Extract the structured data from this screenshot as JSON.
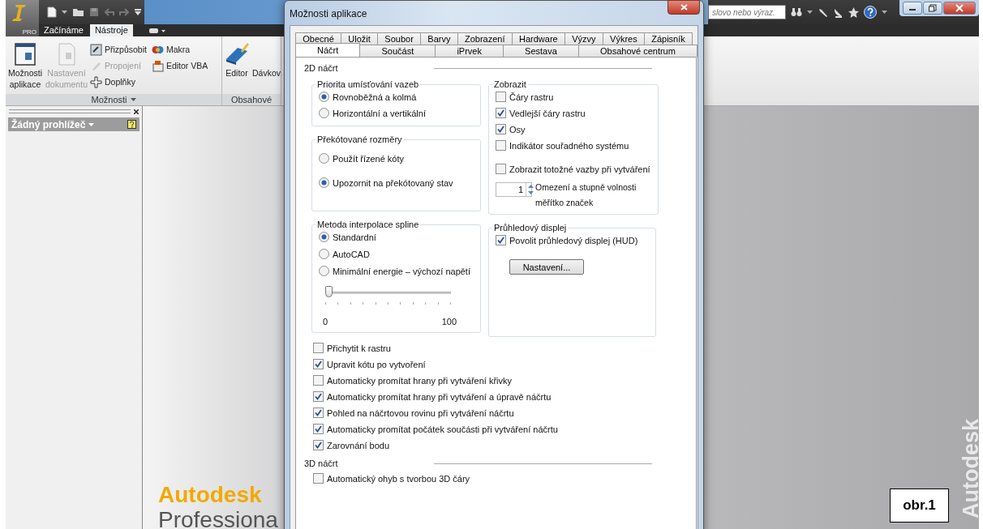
{
  "app": {
    "logo_badge": "PRO",
    "ribbon_tabs": [
      {
        "label": "Začínáme",
        "selected": false
      },
      {
        "label": "Nástroje",
        "selected": true
      }
    ],
    "search": {
      "placeholder": "slovo nebo výraz."
    },
    "ribbon_panels": [
      {
        "title": "Možnosti",
        "large_buttons": [
          {
            "label": "Možnosti aplikace",
            "kind": "window",
            "disabled": false
          },
          {
            "label": "Nastavení dokumentu",
            "kind": "document",
            "disabled": true
          }
        ],
        "small_buttons": [
          {
            "label": "Přizpůsobit",
            "kind": "customize",
            "disabled": false
          },
          {
            "label": "Propojení",
            "kind": "link",
            "disabled": true
          },
          {
            "label": "Doplňky",
            "kind": "plus",
            "disabled": false
          },
          {
            "label": "Makra",
            "kind": "macro",
            "disabled": false
          },
          {
            "label": "Editor VBA",
            "kind": "vba",
            "disabled": false
          }
        ]
      },
      {
        "title": "Obsahové",
        "large_buttons": [
          {
            "label": "Editor",
            "kind": "book",
            "disabled": false
          },
          {
            "label": "Dávkov",
            "kind": "none",
            "disabled": false
          }
        ]
      }
    ],
    "browser": {
      "title": "Žádný prohlížeč"
    },
    "splash": {
      "brand": "Autodesk",
      "product": "Professiona",
      "side_brand": "Autodesk"
    }
  },
  "dialog": {
    "title": "Možnosti aplikace",
    "tab_rows": [
      {
        "tabs": [
          {
            "label": "Obecné",
            "selected": false
          },
          {
            "label": "Uložit",
            "selected": false
          },
          {
            "label": "Soubor",
            "selected": false
          },
          {
            "label": "Barvy",
            "selected": false
          },
          {
            "label": "Zobrazení",
            "selected": false
          },
          {
            "label": "Hardware",
            "selected": false
          },
          {
            "label": "Výzvy",
            "selected": false
          },
          {
            "label": "Výkres",
            "selected": false
          },
          {
            "label": "Zápisník",
            "selected": false
          }
        ]
      },
      {
        "tabs": [
          {
            "label": "Náčrt",
            "selected": true
          },
          {
            "label": "Součást",
            "selected": false
          },
          {
            "label": "iPrvek",
            "selected": false
          },
          {
            "label": "Sestava",
            "selected": false
          },
          {
            "label": "Obsahové centrum",
            "selected": false
          }
        ]
      }
    ],
    "sketch_2d": {
      "title": "2D náčrt",
      "left_groups": [
        {
          "title": "Priorita umísťování vazeb",
          "options": [
            {
              "label": "Rovnoběžná a kolmá",
              "selected": true
            },
            {
              "label": "Horizontální a vertikální",
              "selected": false
            }
          ]
        },
        {
          "title": "Překótované rozměry",
          "options": [
            {
              "label": "Použít řízené kóty",
              "selected": false
            },
            {
              "label": "Upozornit na překótovaný stav",
              "selected": true
            }
          ]
        },
        {
          "title": "Metoda interpolace spline",
          "options": [
            {
              "label": "Standardní",
              "selected": true
            },
            {
              "label": "AutoCAD",
              "selected": false
            },
            {
              "label": "Minimální energie – výchozí napětí",
              "selected": false
            }
          ],
          "slider": {
            "level": 0,
            "min_label": "0",
            "max_label": "100"
          }
        }
      ],
      "right_groups": [
        {
          "title": "Zobrazit",
          "items": [
            {
              "kind": "checkbox",
              "label": "Čáry rastru",
              "checked": false
            },
            {
              "kind": "checkbox",
              "label": "Vedlejší čáry rastru",
              "checked": true
            },
            {
              "kind": "checkbox",
              "label": "Osy",
              "checked": true
            },
            {
              "kind": "checkbox",
              "label": "Indikátor souřadného systému",
              "checked": false
            },
            {
              "kind": "checkbox",
              "label": "Zobrazit totožné vazby při vytváření",
              "checked": false
            },
            {
              "kind": "spinner",
              "value": "1",
              "label": "Omezení a stupně volnosti měřítko značek"
            }
          ]
        },
        {
          "title": "Průhledový displej",
          "items": [
            {
              "kind": "checkbox",
              "label": "Povolit průhledový displej (HUD)",
              "checked": true
            },
            {
              "kind": "button",
              "label": "Nastavení..."
            }
          ]
        }
      ],
      "options": [
        {
          "label": "Přichytit k rastru",
          "checked": false
        },
        {
          "label": "Upravit kótu po vytvoření",
          "checked": true
        },
        {
          "label": "Automaticky promítat hrany při vytváření křivky",
          "checked": false
        },
        {
          "label": "Automaticky promítat hrany při vytváření a úpravě náčrtu",
          "checked": true
        },
        {
          "label": "Pohled na náčrtovou rovinu při vytváření náčrtu",
          "checked": true
        },
        {
          "label": "Automaticky promítat počátek součásti při vytváření náčrtu",
          "checked": true
        },
        {
          "label": "Zarovnání bodu",
          "checked": true
        }
      ]
    },
    "sketch_3d": {
      "title": "3D náčrt",
      "options": [
        {
          "label": "Automatický ohyb s tvorbou 3D čáry",
          "checked": false
        }
      ]
    }
  },
  "figure_label": "obr.1"
}
